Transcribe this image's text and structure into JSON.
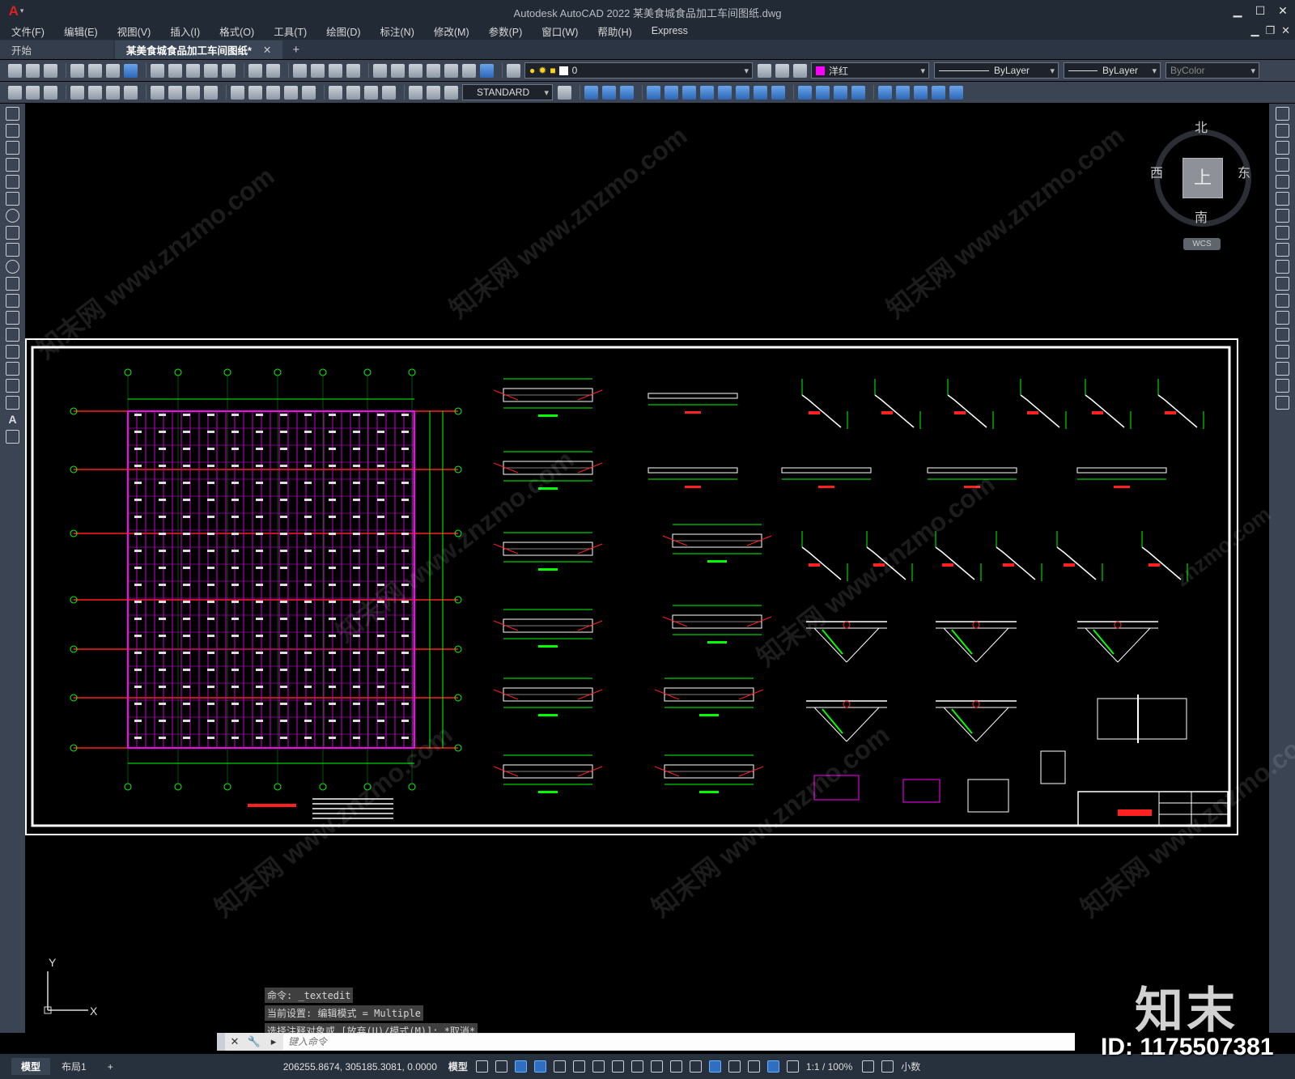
{
  "app": {
    "title": "Autodesk AutoCAD 2022    某美食城食品加工车间图纸.dwg"
  },
  "menu": [
    "文件(F)",
    "编辑(E)",
    "视图(V)",
    "插入(I)",
    "格式(O)",
    "工具(T)",
    "绘图(D)",
    "标注(N)",
    "修改(M)",
    "参数(P)",
    "窗口(W)",
    "帮助(H)",
    "Express"
  ],
  "tabs": {
    "start": "开始",
    "active": "某美食城食品加工车间图纸*",
    "close": "✕",
    "add": "+"
  },
  "toolbar": {
    "layer": "0",
    "color": "洋红",
    "color_hex": "#ff00ff",
    "linetype": "ByLayer",
    "lineweight": "ByLayer",
    "plotstyle": "ByColor",
    "textstyle": "STANDARD"
  },
  "viewcube": {
    "north": "北",
    "south": "南",
    "east": "东",
    "west": "西",
    "face": "上",
    "wcs": "WCS"
  },
  "ucs": {
    "x": "X",
    "y": "Y"
  },
  "command": {
    "history": [
      "命令: _textedit",
      "当前设置: 编辑模式 = Multiple",
      "选择注释对象或 [放弃(U)/模式(M)]: *取消*"
    ],
    "placeholder": "键入命令"
  },
  "status": {
    "model_tab": "模型",
    "layout_tab": "布局1",
    "add": "+",
    "coords": "206255.8674, 305185.3081, 0.0000",
    "space": "模型",
    "scale": "1:1 / 100%",
    "units": "小数"
  },
  "watermark": {
    "site": "znzmo.com",
    "cn": "知末网 www.znzmo.com",
    "logo": "知末",
    "id": "ID: 1175507381"
  }
}
